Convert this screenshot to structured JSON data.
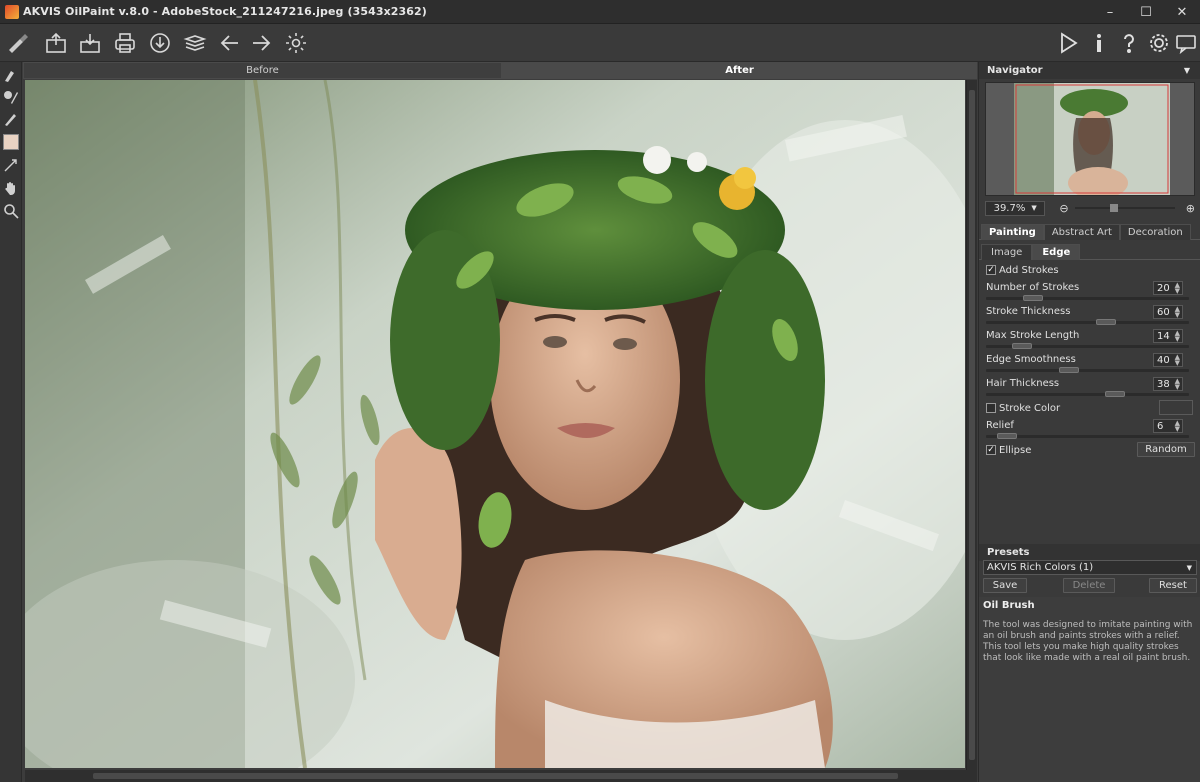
{
  "window": {
    "title": "AKVIS OilPaint v.8.0 - AdobeStock_211247216.jpeg (3543x2362)",
    "minimize": "–",
    "maximize": "☐",
    "close": "✕"
  },
  "toolbar": {
    "left_icons": [
      "brush-logo-icon",
      "open-icon",
      "save-icon",
      "print-icon",
      "share-icon",
      "batch-icon",
      "back-icon",
      "forward-icon",
      "settings-gear-icon"
    ],
    "right_icons": [
      "run-icon",
      "info-icon",
      "help-icon",
      "preferences-icon",
      "notification-icon"
    ]
  },
  "left_tools": [
    "oil-brush-icon",
    "color-brush-icon",
    "history-brush-icon",
    "color-swatch",
    "direction-icon",
    "hand-icon",
    "zoom-icon"
  ],
  "view_tabs": {
    "before": "Before",
    "after": "After",
    "active": "After"
  },
  "navigator": {
    "title": "Navigator",
    "zoom": "39.7%"
  },
  "tabs_main": {
    "painting": "Painting",
    "abstract": "Abstract Art",
    "decoration": "Decoration",
    "active": "Painting"
  },
  "tabs_sub": {
    "image": "Image",
    "edge": "Edge",
    "active": "Edge"
  },
  "params": {
    "add_strokes": {
      "label": "Add Strokes",
      "checked": true
    },
    "num_strokes": {
      "label": "Number of Strokes",
      "value": "20",
      "fraction": 0.2
    },
    "stroke_thickness": {
      "label": "Stroke Thickness",
      "value": "60",
      "fraction": 0.6
    },
    "max_stroke_length": {
      "label": "Max Stroke Length",
      "value": "14",
      "fraction": 0.14
    },
    "edge_smoothness": {
      "label": "Edge Smoothness",
      "value": "40",
      "fraction": 0.4
    },
    "hair_thickness": {
      "label": "Hair Thickness",
      "value": "38",
      "fraction": 0.65
    },
    "stroke_color": {
      "label": "Stroke Color",
      "checked": false
    },
    "relief": {
      "label": "Relief",
      "value": "6",
      "fraction": 0.06
    },
    "ellipse": {
      "label": "Ellipse",
      "checked": true
    },
    "random_label": "Random"
  },
  "presets": {
    "title": "Presets",
    "selected": "AKVIS Rich Colors (1)",
    "save": "Save",
    "delete": "Delete",
    "reset": "Reset"
  },
  "description": {
    "title": "Oil Brush",
    "text": "The tool was designed to imitate painting with an oil brush and paints strokes with a relief. This tool lets you make high quality strokes that look like made with a real oil paint brush."
  },
  "colors": {
    "accent": "#e0a030",
    "panel": "#3a3a3a",
    "canvas_bg": "#b9c6b4"
  }
}
